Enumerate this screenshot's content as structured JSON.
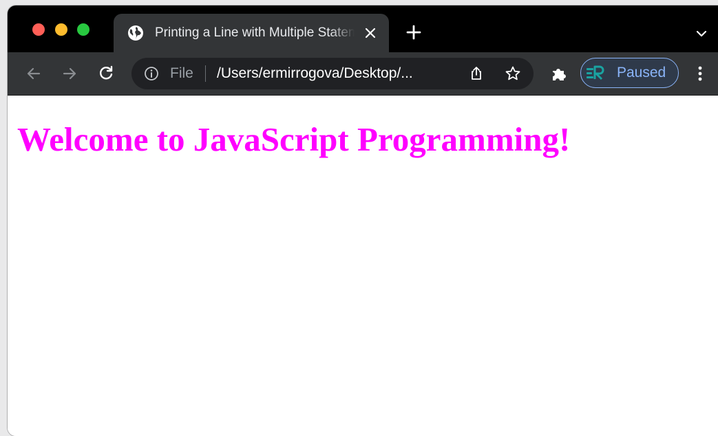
{
  "browser": {
    "tab": {
      "title": "Printing a Line with Multiple Statements"
    },
    "omnibox": {
      "scheme": "File",
      "url": "/Users/ermirrogova/Desktop/..."
    },
    "profile": {
      "label": "Paused"
    },
    "icons": {
      "tab_favicon": "globe-icon",
      "tab_close": "close-icon",
      "new_tab": "plus-icon",
      "tab_search": "chevron-down-icon",
      "back": "arrow-left-icon",
      "forward": "arrow-right-icon",
      "reload": "reload-icon",
      "site_info": "info-icon",
      "share": "share-icon",
      "bookmark": "star-icon",
      "extensions": "puzzle-icon",
      "menu": "kebab-menu-icon"
    },
    "colors": {
      "tabstrip": "#000000",
      "toolbar": "#333537",
      "omnibox": "#202124",
      "profile_accent": "#8ab4f8"
    }
  },
  "page": {
    "heading": "Welcome to JavaScript Programming!",
    "heading_color": "#ff00ff"
  }
}
